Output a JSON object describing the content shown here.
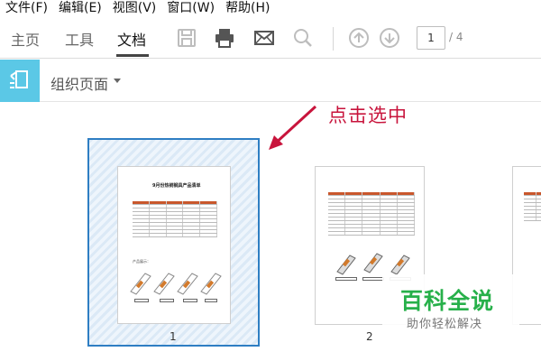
{
  "menu": {
    "items": [
      "文件(F)",
      "编辑(E)",
      "视图(V)",
      "窗口(W)",
      "帮助(H)"
    ]
  },
  "ribbon": {
    "tabs": [
      {
        "label": "主页",
        "active": false
      },
      {
        "label": "工具",
        "active": false
      },
      {
        "label": "文档",
        "active": true
      }
    ],
    "icons": [
      "save-icon",
      "print-icon",
      "mail-icon",
      "search-icon",
      "previous-page-icon",
      "next-page-icon"
    ],
    "current_page": "1",
    "total_pages": "/ 4"
  },
  "organize": {
    "label": "组织页面",
    "icon": "organize-pages-icon",
    "accent": "#5bc8e6"
  },
  "annotation": {
    "text": "点击选中",
    "color": "#c8143c"
  },
  "thumbnails": [
    {
      "number": "1",
      "selected": true
    },
    {
      "number": "2",
      "selected": false
    }
  ],
  "doc_page": {
    "title": "9月份热销钢具产品清单",
    "section_label": "产品展示："
  },
  "watermark": {
    "title": "百科全说",
    "subtitle": "助你轻松解决",
    "color": "#27b04a"
  },
  "colors": {
    "selection_border": "#2e7ec3",
    "table_header": "#c9572c"
  }
}
